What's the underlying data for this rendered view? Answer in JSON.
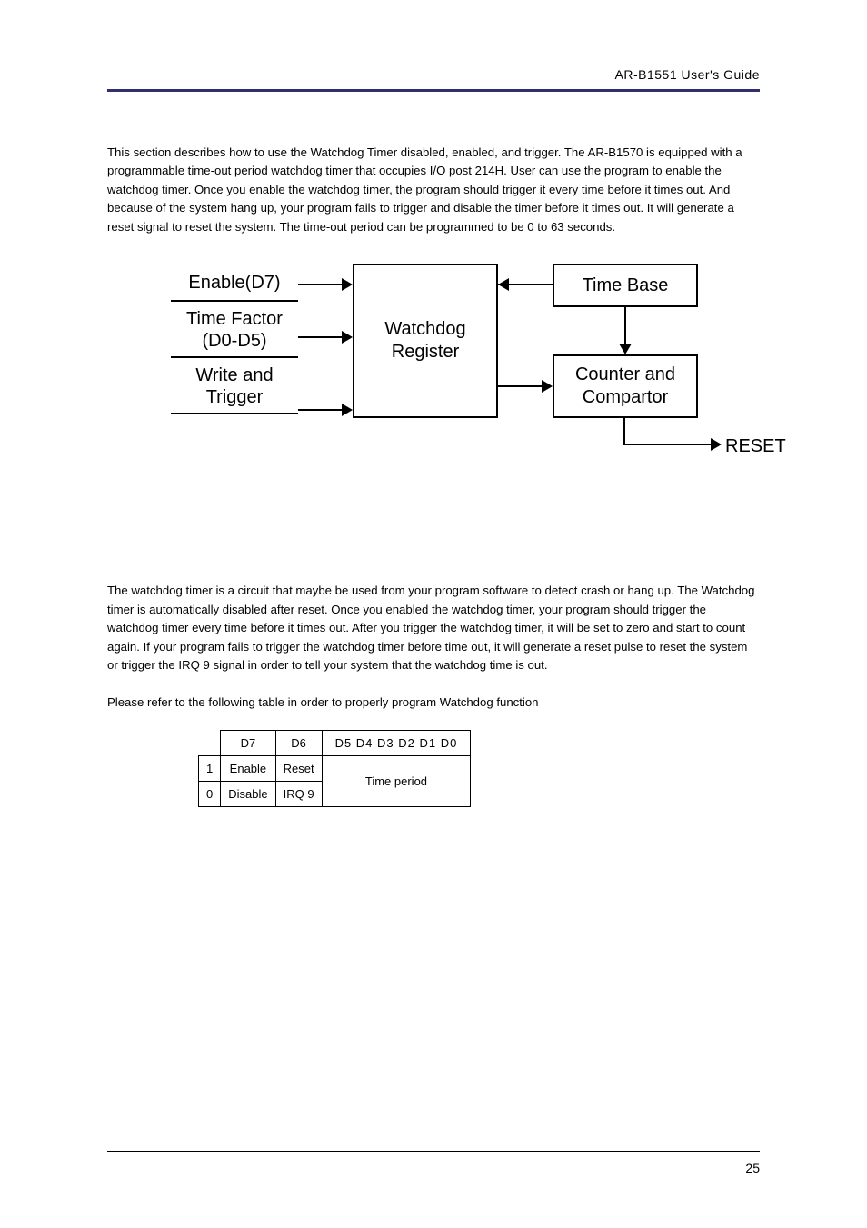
{
  "header": {
    "title": "AR-B1551 User's Guide"
  },
  "footer": {
    "page": "25"
  },
  "paragraphs": {
    "p1": "This section describes how to use the Watchdog Timer disabled, enabled, and trigger. The AR-B1570 is equipped with a programmable time-out period watchdog timer that occupies I/O post 214H. User can use the program to enable the watchdog timer. Once you enable the watchdog timer, the program should trigger it every time before it times out. And because of the system hang up, your program fails to trigger and disable the timer before it times out. It will generate a reset signal to reset the system. The time-out period can be programmed to be 0 to 63 seconds.",
    "p2": "The watchdog timer is a circuit that maybe be used from your program software to detect crash or hang up. The Watchdog timer is automatically disabled after reset. Once you enabled the watchdog timer, your program should trigger the watchdog timer every time before it times out. After you trigger the watchdog timer, it will be set to zero and start to count again. If your program fails to trigger the watchdog timer before time out, it will generate a reset pulse to reset the system or trigger the IRQ 9 signal in order to tell your system that the watchdog time is out.",
    "p3": "Please refer to the following table in order to properly program Watchdog function"
  },
  "diagram": {
    "enable": "Enable(D7)",
    "timefactor1": "Time Factor",
    "timefactor2": "(D0-D5)",
    "writetrigger1": "Write and",
    "writetrigger2": "Trigger",
    "watchdog1": "Watchdog",
    "watchdog2": "Register",
    "timebase": "Time Base",
    "counter1": "Counter and",
    "counter2": "Compartor",
    "reset": "RESET"
  },
  "table": {
    "h_d7": "D7",
    "h_d6": "D6",
    "h_rest": "D5  D4  D3  D2  D1  D0",
    "r1_0": "1",
    "r1_1": "Enable",
    "r1_2": "Reset",
    "r1_3": "Time period",
    "r2_0": "0",
    "r2_1": "Disable",
    "r2_2": "IRQ 9"
  }
}
